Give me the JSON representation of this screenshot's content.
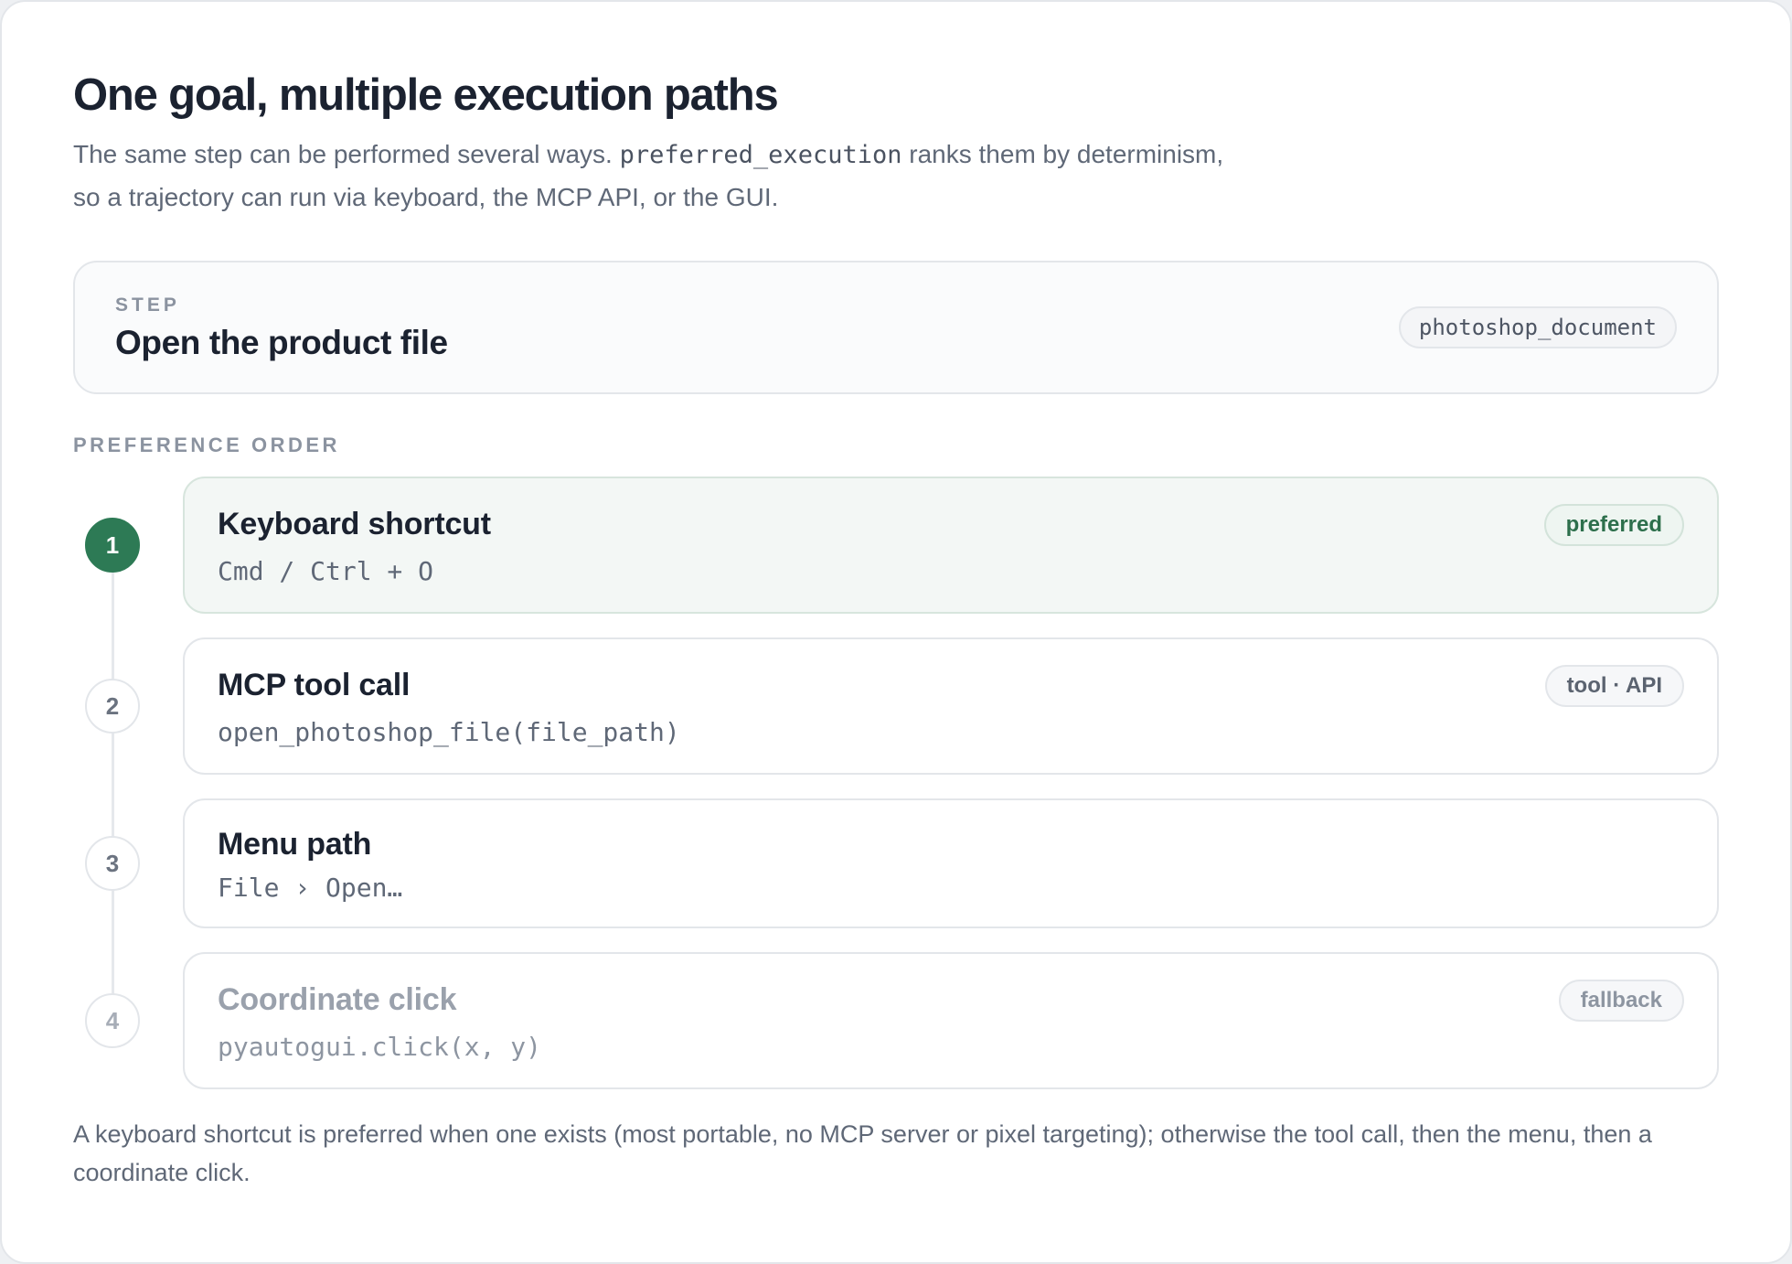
{
  "header": {
    "title": "One goal, multiple execution paths",
    "subtitle_before": "The same step can be performed several ways.",
    "subtitle_code": "preferred_execution",
    "subtitle_after": "ranks them by determinism,",
    "subtitle_line2": "so a trajectory can run via keyboard, the MCP API, or the GUI."
  },
  "step": {
    "eyebrow": "STEP",
    "title": "Open the product file",
    "tag": "photoshop_document"
  },
  "preference": {
    "label": "PREFERENCE ORDER",
    "options": [
      {
        "number": "1",
        "title": "Keyboard shortcut",
        "detail": "Cmd / Ctrl + O",
        "badge": "preferred"
      },
      {
        "number": "2",
        "title": "MCP tool call",
        "detail": "open_photoshop_file(file_path)",
        "badge": "tool · API"
      },
      {
        "number": "3",
        "title": "Menu path",
        "detail": "File › Open…"
      },
      {
        "number": "4",
        "title": "Coordinate click",
        "detail": "pyautogui.click(x, y)",
        "badge": "fallback"
      }
    ]
  },
  "footer": {
    "note": "A keyboard shortcut is preferred when one exists (most portable, no MCP server or pixel targeting); otherwise the tool call, then the menu, then a coordinate click."
  },
  "colors": {
    "accent_green": "#2d7a55",
    "text_dark": "#1b2230",
    "text_muted": "#5f6877"
  }
}
